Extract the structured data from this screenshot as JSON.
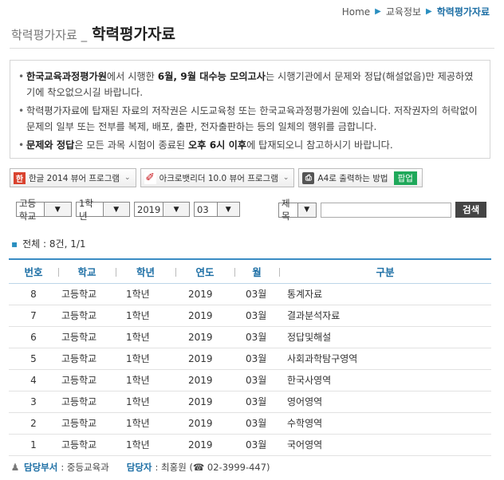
{
  "breadcrumb": {
    "home": "Home",
    "level1": "교육정보",
    "current": "학력평가자료"
  },
  "title": {
    "sub": "학력평가자료 _",
    "main": "학력평가자료"
  },
  "notice": {
    "p1_b1": "한국교육과정평가원",
    "p1_t1": "에서 시행한 ",
    "p1_b2": "6월, 9월 대수능 모의고사",
    "p1_t2": "는 시행기관에서 문제와 정답(해설없음)만 제공하였기에 착오없으시길 바랍니다.",
    "p2": "학력평가자료에 탑재된 자료의 저작권은 시도교육청 또는 한국교육과정평가원에 있습니다. 저작권자의 허락없이 문제의 일부 또는 전부를 복제, 배포, 출판, 전자출판하는 등의 일체의 행위를 금합니다.",
    "p3_b1": "문제와 정답",
    "p3_t1": "은 모든 과목 시험이 종료된 ",
    "p3_b2": "오후 6시 이후",
    "p3_t2": "에 탑재되오니 참고하시기 바랍니다."
  },
  "toolbar": {
    "hwp": "한글 2014 뷰어 프로그램",
    "pdf": "아크로뱃리더 10.0 뷰어 프로그램",
    "print": "A4로 출력하는 방법",
    "popup": "팝업"
  },
  "filters": {
    "school": "고등학교",
    "grade": "1학년",
    "year": "2019",
    "month": "03",
    "field": "제목",
    "search_button": "검색"
  },
  "total": "전체 : 8건, 1/1",
  "table": {
    "headers": [
      "번호",
      "학교",
      "학년",
      "연도",
      "월",
      "구분"
    ],
    "rows": [
      [
        "8",
        "고등학교",
        "1학년",
        "2019",
        "03월",
        "통계자료"
      ],
      [
        "7",
        "고등학교",
        "1학년",
        "2019",
        "03월",
        "결과분석자료"
      ],
      [
        "6",
        "고등학교",
        "1학년",
        "2019",
        "03월",
        "정답및해설"
      ],
      [
        "5",
        "고등학교",
        "1학년",
        "2019",
        "03월",
        "사회과학탐구영역"
      ],
      [
        "4",
        "고등학교",
        "1학년",
        "2019",
        "03월",
        "한국사영역"
      ],
      [
        "3",
        "고등학교",
        "1학년",
        "2019",
        "03월",
        "영어영역"
      ],
      [
        "2",
        "고등학교",
        "1학년",
        "2019",
        "03월",
        "수학영역"
      ],
      [
        "1",
        "고등학교",
        "1학년",
        "2019",
        "03월",
        "국어영역"
      ]
    ]
  },
  "footer": {
    "dept_label": "담당부서",
    "dept": ": 중등교육과",
    "person_label": "담당자",
    "person": ": 최홍원 (☎ 02-3999-447)"
  },
  "colors": {
    "accent": "#1d6fa5",
    "header_rule": "#3a8cc4",
    "popup": "#1fa85a"
  }
}
